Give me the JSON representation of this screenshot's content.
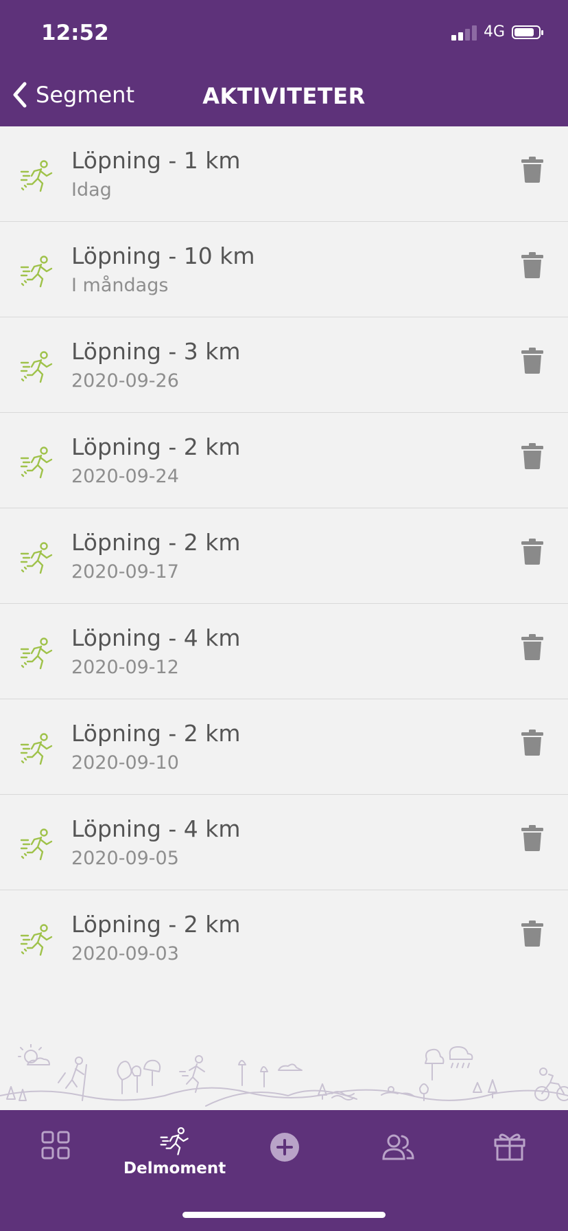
{
  "status": {
    "time": "12:52",
    "network": "4G"
  },
  "nav": {
    "back_label": "Segment",
    "title": "AKTIVITETER"
  },
  "activities": [
    {
      "title": "Löpning - 1 km",
      "date": "Idag"
    },
    {
      "title": "Löpning - 10 km",
      "date": "I måndags"
    },
    {
      "title": "Löpning - 3 km",
      "date": "2020-09-26"
    },
    {
      "title": "Löpning - 2 km",
      "date": "2020-09-24"
    },
    {
      "title": "Löpning - 2 km",
      "date": "2020-09-17"
    },
    {
      "title": "Löpning - 4 km",
      "date": "2020-09-12"
    },
    {
      "title": "Löpning - 2 km",
      "date": "2020-09-10"
    },
    {
      "title": "Löpning - 4 km",
      "date": "2020-09-05"
    },
    {
      "title": "Löpning - 2 km",
      "date": "2020-09-03"
    }
  ],
  "tabs": [
    {
      "icon": "grid-icon",
      "label": ""
    },
    {
      "icon": "runner-icon",
      "label": "Delmoment"
    },
    {
      "icon": "plus-circle-icon",
      "label": ""
    },
    {
      "icon": "people-icon",
      "label": ""
    },
    {
      "icon": "gift-icon",
      "label": ""
    }
  ],
  "colors": {
    "brand": "#5e327a",
    "activity_icon": "#9fc24a",
    "trash": "#8a8a8a",
    "inactive_tab": "#b9a3c8"
  }
}
